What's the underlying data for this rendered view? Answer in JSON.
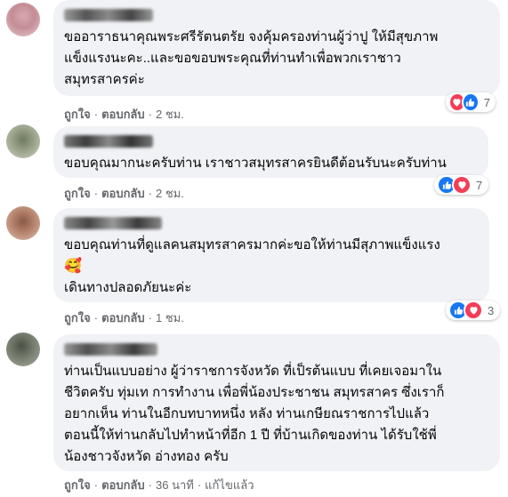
{
  "comments": [
    {
      "text": "ขออาราธนาคุณพระศรีรัตนตรัย จงคุ้มครองท่านผู้ว่าปู ให้มีสุขภาพ\nแข็งแรงนะคะ..และขอขอบพระคุณที่ท่านทำเพื่อพวกเราชาว\nสมุทรสาครค่ะ",
      "like": "ถูกใจ",
      "reply": "ตอบกลับ",
      "time": "2 ชม.",
      "reactions": [
        "love",
        "like"
      ],
      "reaction_count": "7"
    },
    {
      "text": "ขอบคุณมากนะครับท่าน เราชาวสมุทรสาครยินดีต้อนรับนะครับท่าน",
      "like": "ถูกใจ",
      "reply": "ตอบกลับ",
      "time": "2 ชม.",
      "reactions": [
        "like",
        "love"
      ],
      "reaction_count": "7"
    },
    {
      "text": "ขอบคุณท่านที่ดูแลคนสมุทรสาครมากค่ะขอให้ท่านมีสุภาพแข็งแรง",
      "emoji": "🥰",
      "text2": "เดินทางปลอดภัยนะค่ะ",
      "like": "ถูกใจ",
      "reply": "ตอบกลับ",
      "time": "1 ชม.",
      "reactions": [
        "like",
        "love"
      ],
      "reaction_count": "3"
    },
    {
      "text": "ท่านเป็นแบบอย่าง ผู้ว่าราชการจังหวัด ที่เป็รต้นแบบ ที่เคยเจอมาใน\nชีวิตครับ ทุ่มเท การทำงาน เพื่อพี่น้องประชาชน สมุทรสาคร ซึ่งเราก็\nอยากเห็น ท่านในอีกบทบาทหนึ่ง หลัง ท่านเกษียณราชการไปแล้ว\nตอนนี้ให้ท่านกลับไปทำหน้าที่อีก 1 ปี ที่บ้านเกิดของท่าน ได้รับใช้พี่\nน้องชาวจังหวัด อ่างทอง ครับ",
      "like": "ถูกใจ",
      "reply": "ตอบกลับ",
      "time": "36 นาที",
      "edited": "แก้ไขแล้ว"
    }
  ],
  "colors": {
    "bubble": "#f0f2f5",
    "meta": "#65676b",
    "like_blue": "#1877f2",
    "love_red": "#f33e58"
  },
  "icons": {
    "like": "thumbs-up-icon",
    "love": "heart-icon"
  }
}
